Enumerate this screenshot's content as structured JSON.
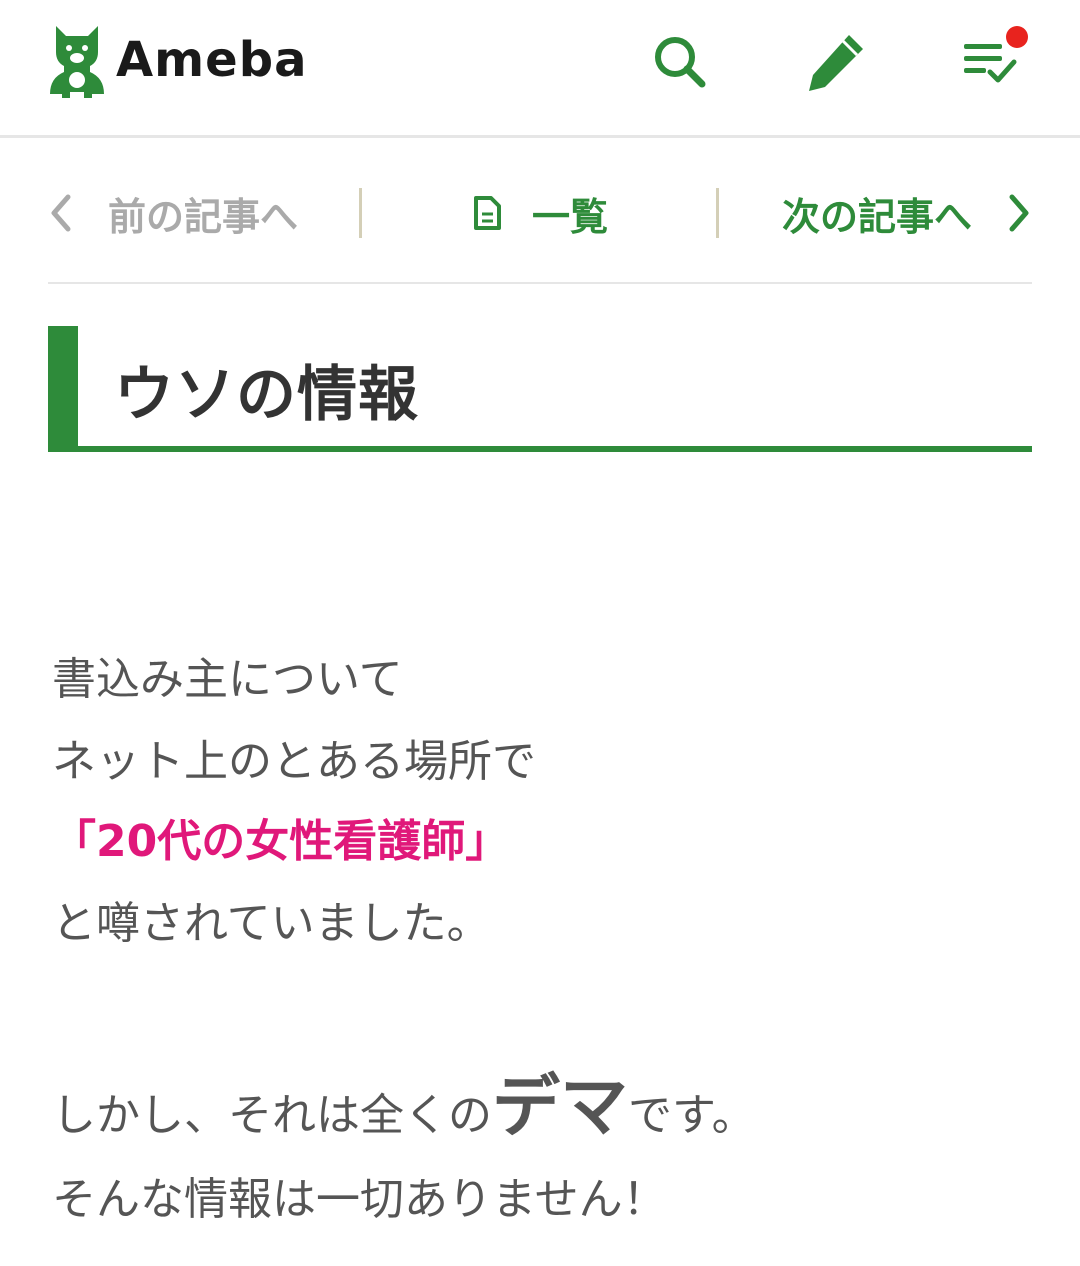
{
  "header": {
    "logo_text": "Ameba",
    "icons": [
      "search-icon",
      "pencil-icon",
      "feed-check-icon"
    ],
    "brand_color": "#2e8b3a",
    "notification_dot_color": "#e8231e"
  },
  "article_nav": {
    "prev_label": "前の記事へ",
    "list_label": "一覧",
    "next_label": "次の記事へ"
  },
  "article": {
    "title": "ウソの情報",
    "lines": [
      "書込み主について",
      "ネット上のとある場所で",
      "「20代の女性看護師」",
      "と噂されていました。"
    ],
    "line5_before": "しかし、それは全くの",
    "line5_emph": "デマ",
    "line5_after": "です。",
    "line6": "そんな情報は一切ありません！",
    "highlight_color": "#e0187a"
  }
}
